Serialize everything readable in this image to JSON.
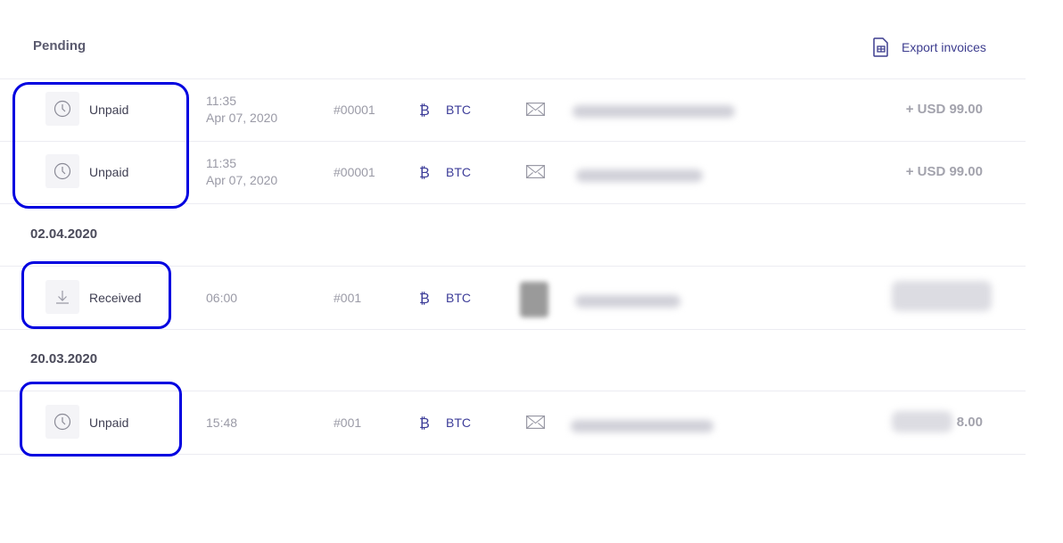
{
  "header": {
    "title": "Pending",
    "export_label": "Export invoices",
    "export_icon": "spreadsheet-file-icon"
  },
  "colors": {
    "accent": "#3d3d99",
    "annotation_outline": "#0000e0",
    "muted_text": "#9a9aa6"
  },
  "sections": [
    {
      "date": "",
      "rows": [
        {
          "status": "Unpaid",
          "status_icon": "clock-icon",
          "time": "11:35",
          "date": "Apr 07, 2020",
          "invoice": "#00001",
          "currency": "BTC",
          "currency_icon": "bitcoin-icon",
          "contact_icon": "envelope-icon",
          "amount": "+ USD 99.00"
        },
        {
          "status": "Unpaid",
          "status_icon": "clock-icon",
          "time": "11:35",
          "date": "Apr 07, 2020",
          "invoice": "#00001",
          "currency": "BTC",
          "currency_icon": "bitcoin-icon",
          "contact_icon": "envelope-icon",
          "amount": "+ USD 99.00"
        }
      ]
    },
    {
      "date": "02.04.2020",
      "rows": [
        {
          "status": "Received",
          "status_icon": "download-arrow-icon",
          "time": "06:00",
          "invoice": "#001",
          "currency": "BTC",
          "currency_icon": "bitcoin-icon",
          "contact_icon": "avatar-icon",
          "amount": ""
        }
      ]
    },
    {
      "date": "20.03.2020",
      "rows": [
        {
          "status": "Unpaid",
          "status_icon": "clock-icon",
          "time": "15:48",
          "invoice": "#001",
          "currency": "BTC",
          "currency_icon": "bitcoin-icon",
          "contact_icon": "envelope-icon",
          "amount": "8.00"
        }
      ]
    }
  ]
}
